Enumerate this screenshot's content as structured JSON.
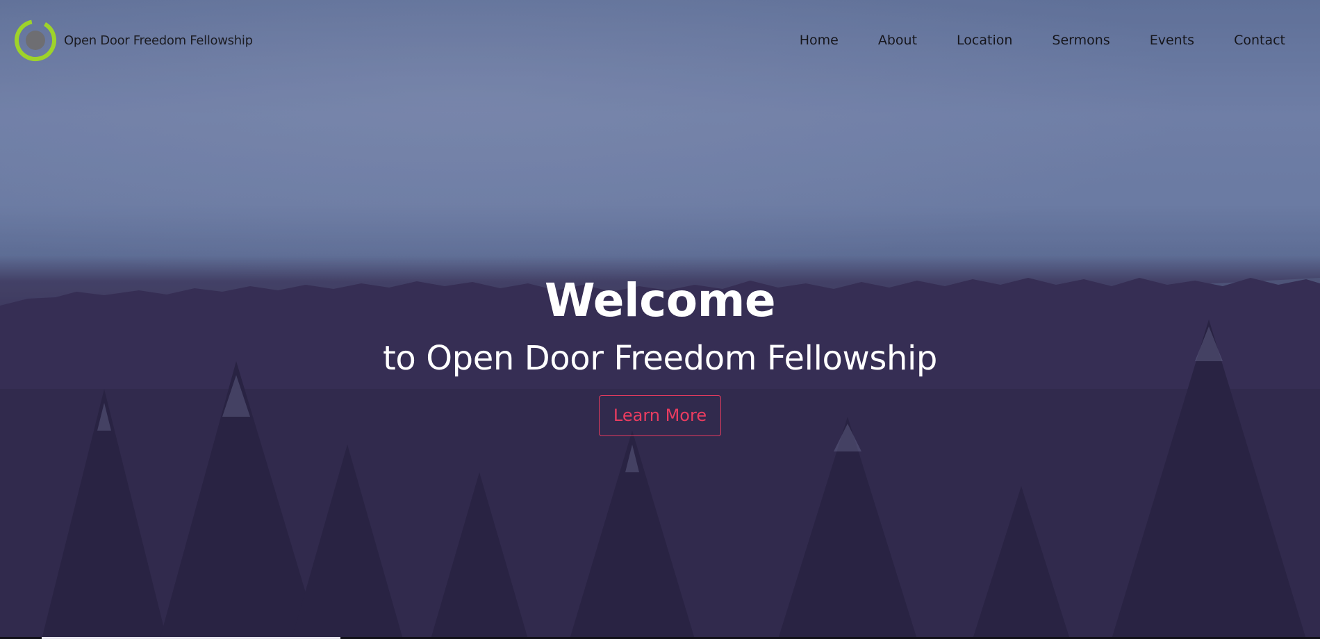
{
  "site": {
    "brand_name": "Open Door Freedom Fellowship",
    "logo_icon": "ring-logo-icon"
  },
  "nav": {
    "items": [
      {
        "label": "Home"
      },
      {
        "label": "About"
      },
      {
        "label": "Location"
      },
      {
        "label": "Sermons"
      },
      {
        "label": "Events"
      },
      {
        "label": "Contact"
      }
    ]
  },
  "hero": {
    "title": "Welcome",
    "subtitle": "to Open Door Freedom Fellowship",
    "cta_label": "Learn More"
  },
  "colors": {
    "accent": "#e23a5e",
    "logo_green": "#9ed32a",
    "logo_gray": "#6e6e72",
    "sky": "#7a90b7",
    "forest": "#352f50"
  }
}
